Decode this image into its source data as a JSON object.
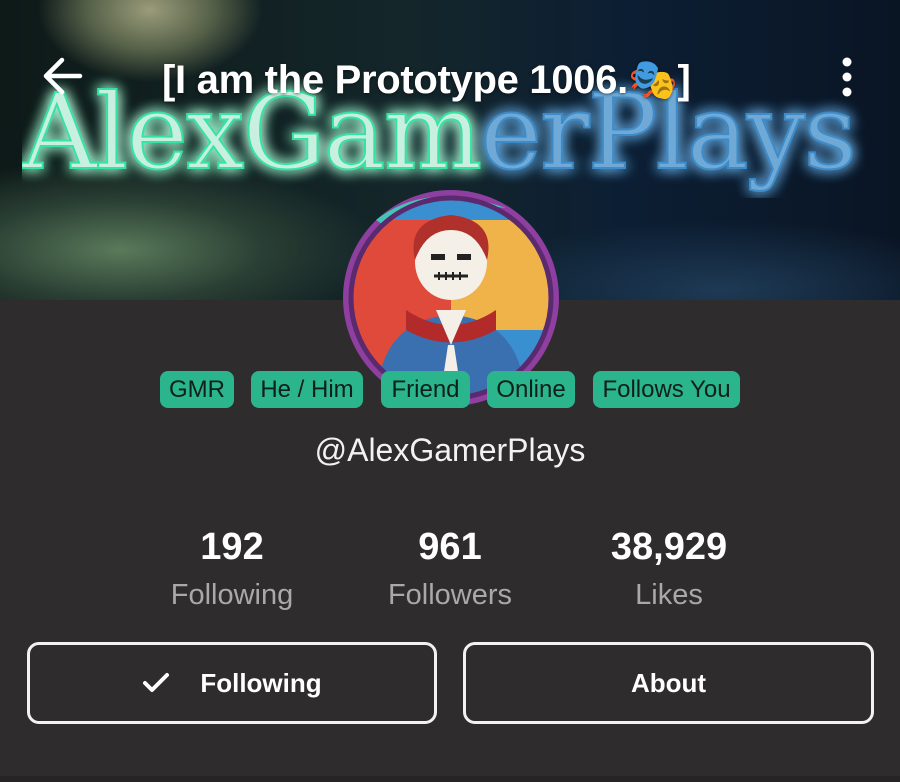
{
  "header": {
    "title": "[I am the Prototype 1006.🎭]",
    "back_icon": "arrow-left-icon",
    "menu_icon": "more-vertical-icon",
    "banner_wordmark": {
      "part1": "AlexGam",
      "part2": "erPlays",
      "colors": {
        "left": "#35e3a3",
        "right": "#4c9ad4"
      }
    }
  },
  "profile": {
    "avatar_icon": "avatar-image",
    "tags": [
      {
        "label": "GMR"
      },
      {
        "label": "He / Him"
      },
      {
        "label": "Friend"
      },
      {
        "label": "Online"
      },
      {
        "label": "Follows You"
      }
    ],
    "handle": "@AlexGamerPlays",
    "stats": [
      {
        "value": "192",
        "label": "Following"
      },
      {
        "value": "961",
        "label": "Followers"
      },
      {
        "value": "38,929",
        "label": "Likes"
      }
    ]
  },
  "actions": {
    "following_label": "Following",
    "following_icon": "check-icon",
    "about_label": "About"
  },
  "colors": {
    "background": "#2e2c2d",
    "tag_background": "#2bb58d",
    "tag_text": "#0f1f1a",
    "stat_label": "#a9a9a9"
  }
}
